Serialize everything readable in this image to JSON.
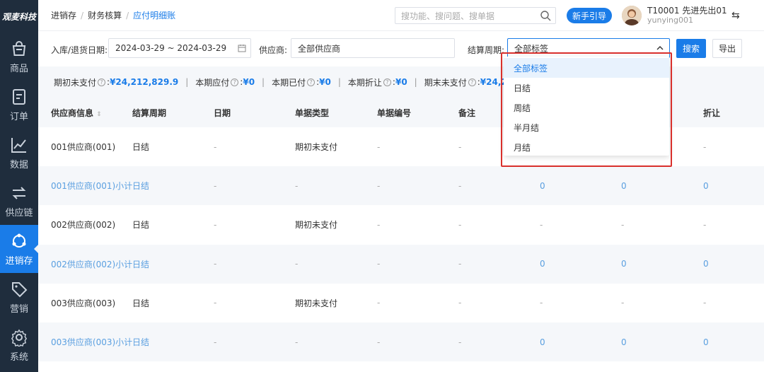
{
  "sidebar": {
    "logo": "观麦科技",
    "items": [
      {
        "label": "商品",
        "icon": "shopping-bag-icon",
        "active": false
      },
      {
        "label": "订单",
        "icon": "order-doc-icon",
        "active": false
      },
      {
        "label": "数据",
        "icon": "line-chart-icon",
        "active": false
      },
      {
        "label": "供应链",
        "icon": "exchange-arrows-icon",
        "active": false
      },
      {
        "label": "进销存",
        "icon": "cycle-nodes-icon",
        "active": true
      },
      {
        "label": "营销",
        "icon": "tag-icon",
        "active": false
      },
      {
        "label": "系统",
        "icon": "gear-icon",
        "active": false
      }
    ]
  },
  "header": {
    "breadcrumb": [
      "进销存",
      "财务核算",
      "应付明细账"
    ],
    "search_placeholder": "搜功能、搜问题、搜单据",
    "guide_label": "新手引导",
    "user_name": "T10001 先进先出01",
    "user_id": "yunying001"
  },
  "filters": {
    "date_label": "入库/退货日期:",
    "date_value": "2024-03-29 ~ 2024-03-29",
    "supplier_label": "供应商:",
    "supplier_value": "全部供应商",
    "cycle_label": "结算周期:",
    "cycle_value": "全部标签",
    "search_button": "搜索",
    "export_button": "导出"
  },
  "summary": {
    "opening_label": "期初未支付",
    "opening_value": "¥24,212,829.9",
    "payable_label": "本期应付",
    "payable_value": "¥0",
    "paid_label": "本期已付",
    "paid_value": "¥0",
    "discount_label": "本期折让",
    "discount_value": "¥0",
    "closing_label": "期末未支付",
    "closing_value": "¥24,21"
  },
  "table": {
    "headers": [
      "供应商信息",
      "结算周期",
      "日期",
      "单据类型",
      "单据编号",
      "备注",
      "",
      "",
      "折让"
    ],
    "rows": [
      {
        "type": "normal",
        "cells": [
          "001供应商(001)",
          "日结",
          "-",
          "期初未支付",
          "-",
          "-",
          "",
          "",
          "-"
        ]
      },
      {
        "type": "sub",
        "cells": [
          "001供应商(001)小计",
          "日结",
          "-",
          "-",
          "-",
          "-",
          "0",
          "0",
          "0"
        ]
      },
      {
        "type": "normal",
        "cells": [
          "002供应商(002)",
          "日结",
          "-",
          "期初未支付",
          "-",
          "-",
          "-",
          "-",
          "-"
        ]
      },
      {
        "type": "sub",
        "cells": [
          "002供应商(002)小计",
          "日结",
          "-",
          "-",
          "-",
          "-",
          "0",
          "0",
          "0"
        ]
      },
      {
        "type": "normal",
        "cells": [
          "003供应商(003)",
          "日结",
          "-",
          "期初未支付",
          "-",
          "-",
          "-",
          "-",
          "-"
        ]
      },
      {
        "type": "sub",
        "cells": [
          "003供应商(003)小计",
          "日结",
          "-",
          "-",
          "-",
          "-",
          "0",
          "0",
          "0"
        ]
      }
    ]
  },
  "dropdown": {
    "options": [
      "全部标签",
      "日结",
      "周结",
      "半月结",
      "月结"
    ],
    "selected_index": 0
  },
  "colors": {
    "sidebar_bg": "#1f2d3d",
    "accent": "#1a7ce8",
    "highlight_border": "#d9302c"
  }
}
